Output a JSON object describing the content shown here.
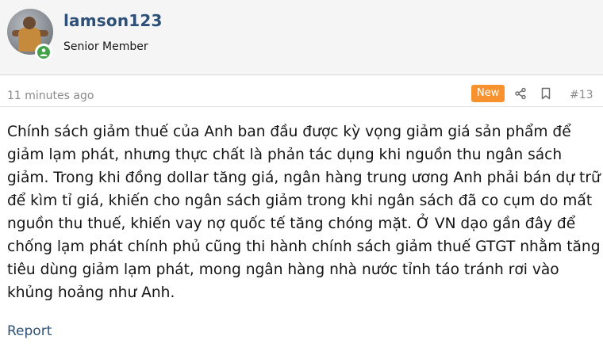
{
  "user": {
    "name": "lamson123",
    "title": "Senior Member",
    "online": true
  },
  "post": {
    "time": "11 minutes ago",
    "badge": "New",
    "number": "#13",
    "body": "Chính sách giảm thuế của Anh ban đầu được kỳ vọng giảm giá sản phẩm để giảm lạm phát, nhưng thực chất là phản tác dụng khi nguồn thu ngân sách giảm. Trong khi đồng dollar tăng giá, ngân hàng trung ương Anh phải bán dự trữ để kìm tỉ giá, khiến cho ngân sách giảm trong khi ngân sách đã co cụm do mất nguồn thu thuế, khiến vay nợ quốc tế tăng chóng mặt. Ở VN dạo gần đây để chống lạm phát chính phủ cũng thi hành chính sách giảm thuế GTGT nhằm tăng tiêu dùng giảm lạm phát, mong ngân hàng nhà nước tỉnh táo tránh rơi vào khủng hoảng như Anh.",
    "report_label": "Report"
  },
  "icons": {
    "share": "share-icon",
    "bookmark": "bookmark-icon",
    "online": "online-status-icon"
  },
  "colors": {
    "username": "#2c5078",
    "badge_new": "#f8922f",
    "online": "#42a24a",
    "header_bg": "#f5f5f5"
  }
}
